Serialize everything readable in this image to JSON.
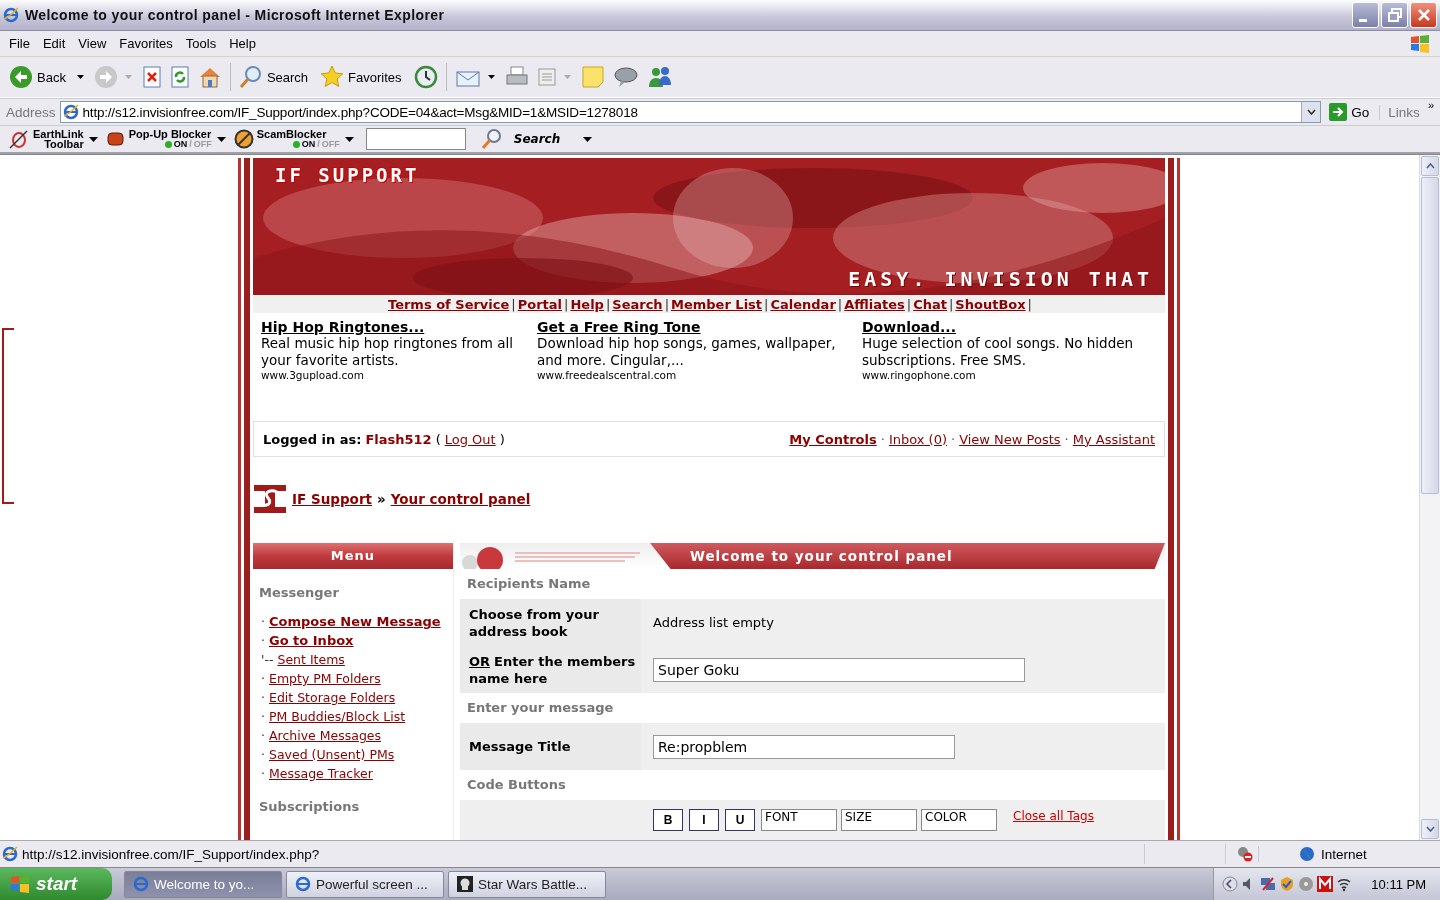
{
  "window": {
    "title": "Welcome to your control panel - Microsoft Internet Explorer"
  },
  "menu_bar": [
    "File",
    "Edit",
    "View",
    "Favorites",
    "Tools",
    "Help"
  ],
  "toolbar": [
    {
      "kind": "back",
      "label": "Back",
      "dropdown": true
    },
    {
      "kind": "forward",
      "dropdown": true
    },
    {
      "kind": "stop"
    },
    {
      "kind": "refresh"
    },
    {
      "kind": "home"
    },
    {
      "kind": "search",
      "label": "Search"
    },
    {
      "kind": "favorites",
      "label": "Favorites"
    },
    {
      "kind": "history"
    },
    {
      "kind": "mail",
      "dropdown": true
    },
    {
      "kind": "print"
    },
    {
      "kind": "edit",
      "dropdown": true
    },
    {
      "kind": "note"
    },
    {
      "kind": "discuss"
    },
    {
      "kind": "messenger"
    }
  ],
  "address_bar": {
    "label": "Address",
    "url": "http://s12.invisionfree.com/IF_Support/index.php?CODE=04&act=Msg&MID=1&MSID=1278018",
    "go": "Go",
    "links": "Links",
    "more": "»"
  },
  "earthlink_toolbar": {
    "brand": "EarthLink",
    "brand_sub": "Toolbar",
    "blockers": [
      {
        "name": "Pop-Up Blocker",
        "on": "ON",
        "divider": "/",
        "off": "OFF"
      },
      {
        "name": "ScamBlocker",
        "on": "ON",
        "divider": "/",
        "off": "OFF"
      }
    ],
    "search": "Search"
  },
  "page": {
    "banner": {
      "title": "IF SUPPORT",
      "tagline": "EASY. INVISION THAT"
    },
    "nav": {
      "separator": "|",
      "links": [
        "Terms of Service",
        "Portal",
        "Help",
        "Search",
        "Member List",
        "Calendar",
        "Affliates",
        "Chat",
        "ShoutBox"
      ]
    },
    "ads": [
      {
        "title": "Hip Hop Ringtones...",
        "text": "Real music hip hop ringtones from all your favorite artists.",
        "url": "www.3gupload.com"
      },
      {
        "title": "Get a Free Ring Tone",
        "text": "Download hip hop songs, games, wallpaper, and more. Cingular,...",
        "url": "www.freedealscentral.com"
      },
      {
        "title": "Download...",
        "text": "Huge selection of cool songs. No hidden subscriptions. Free SMS.",
        "url": "www.ringophone.com"
      }
    ],
    "user_bar": {
      "label": "Logged in as:",
      "user": "Flash512",
      "open": "(",
      "logout": "Log Out",
      "close": ")",
      "separator": "·",
      "links": [
        {
          "label": "My Controls",
          "bold": true
        },
        {
          "label": "Inbox (0)",
          "bold": false
        },
        {
          "label": "View New Posts",
          "bold": false
        },
        {
          "label": "My Assistant",
          "bold": false
        }
      ]
    },
    "breadcrumb": {
      "separator": "»",
      "links": [
        "IF Support",
        "Your control panel"
      ]
    },
    "menu": {
      "title": "Menu",
      "sections": [
        {
          "heading": "Messenger",
          "items": [
            {
              "marker": "·",
              "label": "Compose New Message",
              "bold": true
            },
            {
              "marker": "·",
              "label": "Go to Inbox",
              "bold": true,
              "children": [
                {
                  "marker": "'--",
                  "label": "Sent Items",
                  "bold": false
                }
              ]
            },
            {
              "marker": "·",
              "label": "Empty PM Folders",
              "bold": false
            },
            {
              "marker": "·",
              "label": "Edit Storage Folders",
              "bold": false
            },
            {
              "marker": "·",
              "label": "PM Buddies/Block List",
              "bold": false
            },
            {
              "marker": "·",
              "label": "Archive Messages",
              "bold": false
            },
            {
              "marker": "·",
              "label": "Saved (Unsent) PMs",
              "bold": false
            },
            {
              "marker": "·",
              "label": "Message Tracker",
              "bold": false
            }
          ]
        },
        {
          "heading": "Subscriptions"
        }
      ]
    },
    "panel": {
      "title": "Welcome to your control panel",
      "rows": [
        {
          "kind": "header",
          "label": "Recipients Name"
        },
        {
          "kind": "text",
          "label": "Choose from your address book",
          "value": "Address list empty"
        },
        {
          "kind": "input",
          "prefix": "OR",
          "label": "Enter the members name here",
          "value": "Super Goku",
          "wide": true
        },
        {
          "kind": "header",
          "label": "Enter your message"
        },
        {
          "kind": "input",
          "label": "Message Title",
          "value": "Re:propblem",
          "wide": false
        },
        {
          "kind": "header",
          "label": "Code Buttons"
        },
        {
          "kind": "codes",
          "buttons": [
            "B",
            "I",
            "U"
          ],
          "selects": [
            "FONT",
            "SIZE",
            "COLOR"
          ],
          "link": "Close all Tags"
        }
      ]
    }
  },
  "status_bar": {
    "url": "http://s12.invisionfree.com/IF_Support/index.php?",
    "zone": "Internet"
  },
  "taskbar": {
    "start": "start",
    "tasks": [
      {
        "label": "Welcome to yo...",
        "selected": true
      },
      {
        "label": "Powerful screen ...",
        "selected": false
      },
      {
        "label": "Star Wars Battle...",
        "selected": false
      }
    ],
    "clock": "10:11 PM"
  }
}
